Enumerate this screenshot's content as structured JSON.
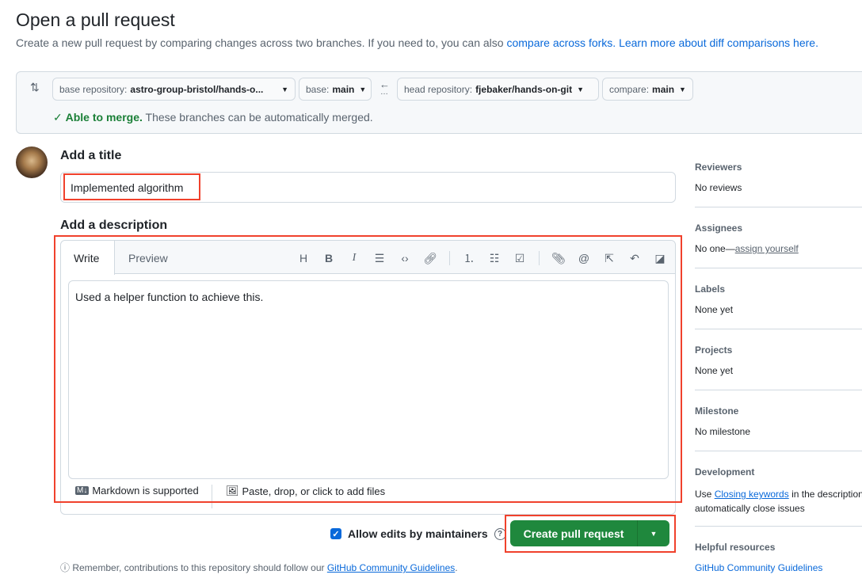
{
  "header": {
    "title": "Open a pull request",
    "subtitle": "Create a new pull request by comparing changes across two branches. If you need to, you can also ",
    "link1": "compare across forks.",
    "link2": "Learn more about diff comparisons here."
  },
  "compare": {
    "base_repo_label": "base repository:",
    "base_repo": "astro-group-bristol/hands-o...",
    "base_label": "base:",
    "base": "main",
    "head_repo_label": "head repository:",
    "head_repo": "fjebaker/hands-on-git",
    "compare_label": "compare:",
    "compare": "main",
    "merge_status": "Able to merge.",
    "merge_text": " These branches can be automatically merged."
  },
  "form": {
    "title_label": "Add a title",
    "title_value": "Implemented algorithm",
    "desc_label": "Add a description",
    "tab_write": "Write",
    "tab_preview": "Preview",
    "description": "Used a helper function to achieve this.",
    "markdown": "Markdown is supported",
    "attach": "Paste, drop, or click to add files",
    "allow_edits": "Allow edits by maintainers",
    "allow_edits_checked": true,
    "submit": "Create pull request",
    "reminder": "Remember, contributions to this repository should follow our ",
    "guidelines": "GitHub Community Guidelines"
  },
  "sidebar": {
    "reviewers": {
      "title": "Reviewers",
      "value": "No reviews"
    },
    "assignees": {
      "title": "Assignees",
      "value": "No one—",
      "link": "assign yourself"
    },
    "labels": {
      "title": "Labels",
      "value": "None yet"
    },
    "projects": {
      "title": "Projects",
      "value": "None yet"
    },
    "milestone": {
      "title": "Milestone",
      "value": "No milestone"
    },
    "development": {
      "title": "Development",
      "pre": "Use ",
      "link": "Closing keywords",
      "post": " in the description to",
      "line2": "automatically close issues"
    },
    "helpful": {
      "title": "Helpful resources",
      "link": "GitHub Community Guidelines"
    }
  },
  "colors": {
    "accent": "#0969da",
    "success": "#1f883d",
    "highlight": "#f0412c"
  }
}
